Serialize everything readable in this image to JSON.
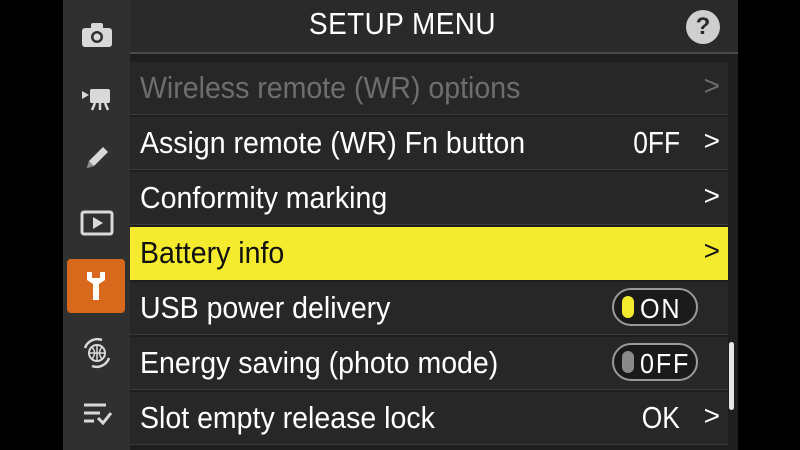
{
  "header": {
    "title": "SETUP MENU",
    "help_label": "?"
  },
  "sidebar": {
    "items": [
      {
        "icon": "camera-icon",
        "active": false
      },
      {
        "icon": "movie-camera-icon",
        "active": false
      },
      {
        "icon": "pencil-icon",
        "active": false
      },
      {
        "icon": "playback-icon",
        "active": false
      },
      {
        "icon": "wrench-icon",
        "active": true
      },
      {
        "icon": "network-icon",
        "active": false
      },
      {
        "icon": "my-menu-icon",
        "active": false
      }
    ]
  },
  "menu": {
    "items": [
      {
        "label": "Wireless remote (WR) options",
        "value": "",
        "chevron": ">",
        "state": "disabled"
      },
      {
        "label": "Assign remote (WR) Fn button",
        "value": "0FF",
        "chevron": ">",
        "state": "normal"
      },
      {
        "label": "Conformity marking",
        "value": "",
        "chevron": ">",
        "state": "normal"
      },
      {
        "label": "Battery info",
        "value": "",
        "chevron": ">",
        "state": "selected"
      },
      {
        "label": "USB power delivery",
        "toggle": "ON",
        "state": "normal"
      },
      {
        "label": "Energy saving (photo mode)",
        "toggle": "0FF",
        "state": "normal"
      },
      {
        "label": "Slot empty release lock",
        "value": "OK",
        "chevron": ">",
        "state": "normal"
      }
    ]
  },
  "colors": {
    "accent_active_tab": "#d8691c",
    "selection": "#f4ea2e",
    "toggle_on_knob": "#f4ea2e"
  },
  "scrollbar": {
    "position_fraction": 0.85
  }
}
